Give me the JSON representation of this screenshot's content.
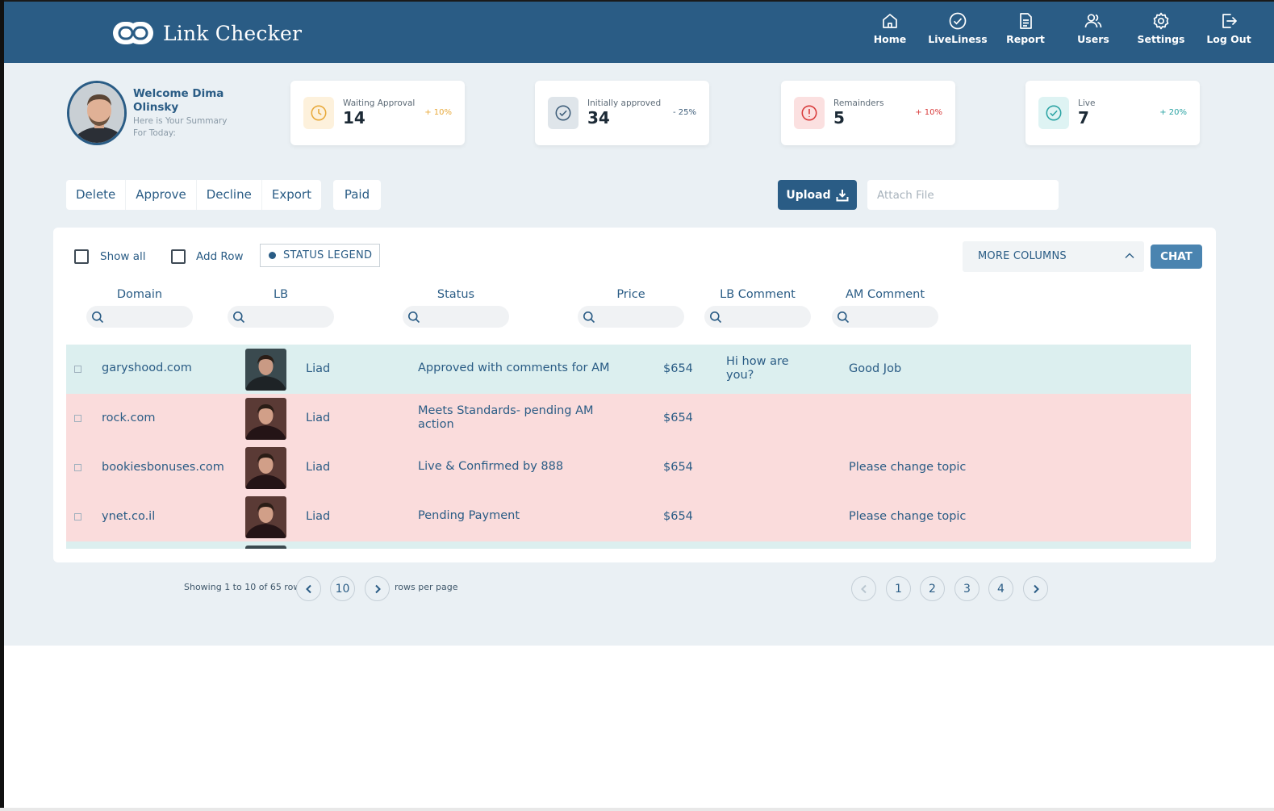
{
  "app": {
    "title": "Link Checker"
  },
  "nav": [
    {
      "label": "Home",
      "icon": "home-icon"
    },
    {
      "label": "LiveLiness",
      "icon": "check-circle-icon"
    },
    {
      "label": "Report",
      "icon": "document-icon"
    },
    {
      "label": "Users",
      "icon": "users-icon"
    },
    {
      "label": "Settings",
      "icon": "gear-icon"
    },
    {
      "label": "Log Out",
      "icon": "logout-icon"
    }
  ],
  "welcome": {
    "title": "Welcome Dima Olinsky",
    "subtitle": "Here is Your Summary For Today:"
  },
  "stats": [
    {
      "label": "Waiting Approval",
      "value": "14",
      "change": "+ 10%",
      "icon": "clock-icon",
      "color": "#e8a93a",
      "bg": "#fdf1dc"
    },
    {
      "label": "Initially approved",
      "value": "34",
      "change": "- 25%",
      "icon": "check-circle-icon",
      "color": "#3f5e7a",
      "bg": "#dfe5ea"
    },
    {
      "label": "Remainders",
      "value": "5",
      "change": "+ 10%",
      "icon": "alert-circle-icon",
      "color": "#d83a3a",
      "bg": "#fbe0e0"
    },
    {
      "label": "Live",
      "value": "7",
      "change": "+ 20%",
      "icon": "check-circle-icon",
      "color": "#2aa3a3",
      "bg": "#def3f3"
    }
  ],
  "actions": {
    "delete": "Delete",
    "approve": "Approve",
    "decline": "Decline",
    "export": "Export",
    "paid": "Paid"
  },
  "upload": {
    "label": "Upload",
    "attach_placeholder": "Attach File"
  },
  "table_controls": {
    "show_all": "Show all",
    "add_row": "Add Row",
    "status_legend": "STATUS LEGEND",
    "more_columns": "MORE COLUMNS",
    "chat": "CHAT"
  },
  "columns": [
    "Domain",
    "LB",
    "Status",
    "Price",
    "LB Comment",
    "AM Comment"
  ],
  "rows": [
    {
      "domain": "garyshood.com",
      "lb": "Liad",
      "status": "Approved with comments for AM",
      "price": "$654",
      "lb_comment": "Hi how are you?",
      "am_comment": "Good Job",
      "bg": "#dcefef"
    },
    {
      "domain": "rock.com",
      "lb": "Liad",
      "status": "Meets Standards- pending AM action",
      "price": "$654",
      "lb_comment": "",
      "am_comment": "",
      "bg": "#fadcdc"
    },
    {
      "domain": "bookiesbonuses.com",
      "lb": "Liad",
      "status": "Live & Confirmed by 888",
      "price": "$654",
      "lb_comment": "",
      "am_comment": "Please change topic",
      "bg": "#fadcdc"
    },
    {
      "domain": "ynet.co.il",
      "lb": "Liad",
      "status": "Pending Payment",
      "price": "$654",
      "lb_comment": "",
      "am_comment": "Please change topic",
      "bg": "#fadcdc"
    },
    {
      "domain": "",
      "lb": "",
      "status": "",
      "price": "",
      "lb_comment": "",
      "am_comment": "",
      "bg": "#dcefef"
    }
  ],
  "pagination": {
    "showing": "Showing 1 to 10 of 65 rows",
    "per_page": "10",
    "per_page_label": "rows per page",
    "pages": [
      "1",
      "2",
      "3",
      "4"
    ]
  },
  "colors": {
    "primary": "#2a5c85",
    "background": "#eaf0f4"
  }
}
